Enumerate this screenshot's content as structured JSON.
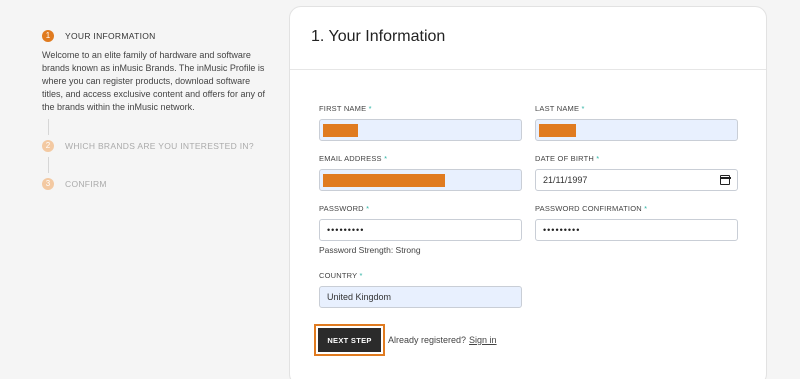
{
  "stepper": {
    "steps": [
      {
        "num": "1",
        "label": "YOUR INFORMATION"
      },
      {
        "num": "2",
        "label": "WHICH BRANDS ARE YOU INTERESTED IN?"
      },
      {
        "num": "3",
        "label": "CONFIRM"
      }
    ],
    "description": "Welcome to an elite family of hardware and software brands known as inMusic Brands. The inMusic Profile is where you can register products, download software titles, and access exclusive content and offers for any of the brands within the inMusic network."
  },
  "form": {
    "title": "1. Your Information",
    "first_name": {
      "label": "FIRST NAME",
      "value": ""
    },
    "last_name": {
      "label": "LAST NAME",
      "value": ""
    },
    "email": {
      "label": "EMAIL ADDRESS",
      "value": ""
    },
    "dob": {
      "label": "DATE OF BIRTH",
      "value": "21/11/1997"
    },
    "password": {
      "label": "PASSWORD",
      "value": "•••••••••"
    },
    "password_confirm": {
      "label": "PASSWORD CONFIRMATION",
      "value": "•••••••••"
    },
    "password_strength": "Password Strength: Strong",
    "country": {
      "label": "COUNTRY",
      "value": "United Kingdom"
    },
    "required_mark": "*",
    "next_label": "NEXT STEP",
    "already_text": "Already registered?",
    "signin_text": "Sign in"
  },
  "colors": {
    "accent": "#e07b20",
    "required": "#2eb3a4",
    "autofill": "#e8f0fe"
  }
}
